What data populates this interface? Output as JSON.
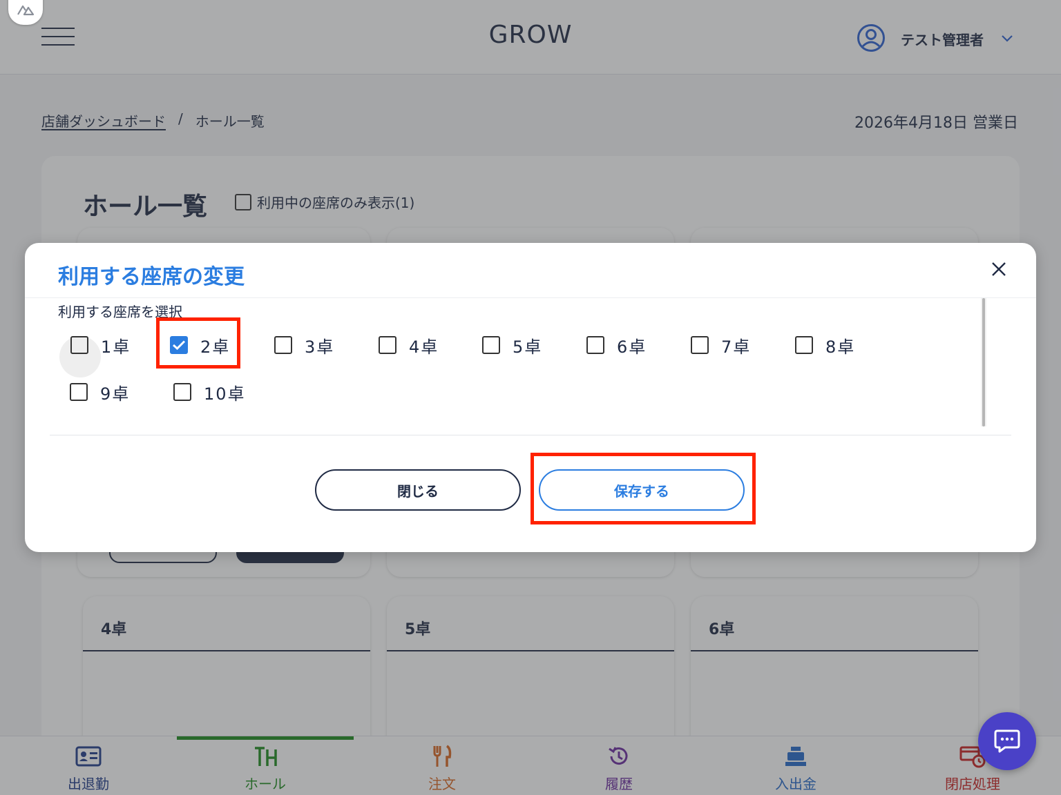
{
  "header": {
    "brand": "GROW",
    "user_name": "テスト管理者"
  },
  "breadcrumb": {
    "home": "店舗ダッシュボード",
    "separator": "/",
    "current": "ホール一覧"
  },
  "business_date": "2026年4月18日 営業日",
  "page": {
    "title": "ホール一覧",
    "filter_label": "利用中の座席のみ表示(1)"
  },
  "tables": [
    {
      "name": "4卓"
    },
    {
      "name": "5卓"
    },
    {
      "name": "6卓"
    }
  ],
  "modal": {
    "title": "利用する座席の変更",
    "subtitle": "利用する座席を選択",
    "seats": [
      {
        "label": "1卓",
        "checked": false
      },
      {
        "label": "2卓",
        "checked": true
      },
      {
        "label": "3卓",
        "checked": false
      },
      {
        "label": "4卓",
        "checked": false
      },
      {
        "label": "5卓",
        "checked": false
      },
      {
        "label": "6卓",
        "checked": false
      },
      {
        "label": "7卓",
        "checked": false
      },
      {
        "label": "8卓",
        "checked": false
      },
      {
        "label": "9卓",
        "checked": false
      },
      {
        "label": "10卓",
        "checked": false
      }
    ],
    "close_label": "閉じる",
    "save_label": "保存する"
  },
  "bottom_nav": [
    {
      "label": "出退勤",
      "icon": "id-card-icon",
      "color": "#1f3a8a"
    },
    {
      "label": "ホール",
      "icon": "table-icon",
      "color": "#1c8a1c",
      "active": true
    },
    {
      "label": "注文",
      "icon": "fork-knife-icon",
      "color": "#d9641e"
    },
    {
      "label": "履歴",
      "icon": "history-icon",
      "color": "#6a2a9e"
    },
    {
      "label": "入出金",
      "icon": "cash-register-icon",
      "color": "#2468c8"
    },
    {
      "label": "閉店処理",
      "icon": "store-close-icon",
      "color": "#c81e1e"
    }
  ],
  "colors": {
    "accent": "#2b7de0",
    "text": "#1f2a44",
    "highlight": "#ff2200"
  }
}
